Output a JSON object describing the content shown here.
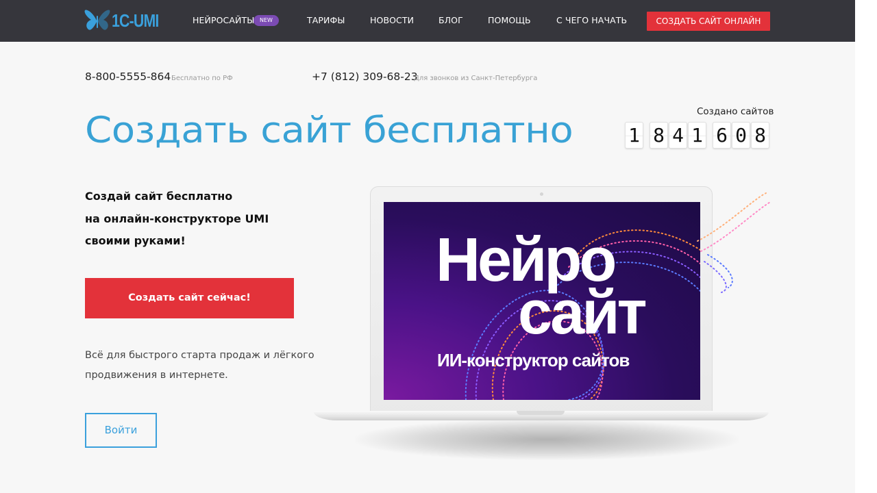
{
  "nav": {
    "logo_text": "1C-UMI",
    "items": [
      {
        "label": "НЕЙРОСАЙТЫ"
      },
      {
        "label": "ТАРИФЫ"
      },
      {
        "label": "НОВОСТИ"
      },
      {
        "label": "БЛОГ"
      },
      {
        "label": "ПОМОЩЬ"
      },
      {
        "label": "С ЧЕГО НАЧАТЬ"
      }
    ],
    "badge": "NEW",
    "cta": "СОЗДАТЬ САЙТ ОНЛАЙН"
  },
  "contacts": {
    "phone1": "8-800-5555-864",
    "phone1_note": "Бесплатно по РФ",
    "phone2": "+7 (812) 309-68-23",
    "phone2_note": "Для звонков из Санкт-Петербурга"
  },
  "hero": {
    "title": "Создать сайт бесплатно",
    "subhead_lines": [
      "Создай сайт бесплатно",
      "на онлайн-конструкторе UMI",
      "своими руками!"
    ],
    "cta": "Создать сайт сейчас!",
    "description": "Всё для быстрого старта продаж и лёгкого продвижения в интернете.",
    "login": "Войти"
  },
  "counter": {
    "label": "Создано сайтов",
    "digits": [
      "1",
      "8",
      "4",
      "1",
      "6",
      "0",
      "8"
    ]
  },
  "screen": {
    "title_line1": "Нейро",
    "title_line2": "сайт",
    "subtitle": "ИИ-конструктор сайтов"
  },
  "colors": {
    "nav_bg": "#36363c",
    "accent_red": "#e3323a",
    "accent_blue": "#39a2d5",
    "badge_purple": "#7b4bb3"
  },
  "icons": {
    "logo": "butterfly-icon"
  }
}
